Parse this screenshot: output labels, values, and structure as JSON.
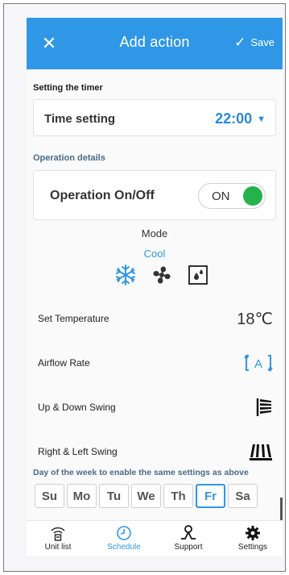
{
  "header": {
    "title": "Add action",
    "save_label": "Save",
    "close_icon": "close-icon",
    "accent": "#2f97e6"
  },
  "timer": {
    "section_label": "Setting the timer",
    "label": "Time setting",
    "value": "22:00"
  },
  "operation": {
    "section_label": "Operation details",
    "label": "Operation On/Off",
    "toggle_text": "ON",
    "toggle_on": true,
    "toggle_color": "#24b34b"
  },
  "mode": {
    "label": "Mode",
    "selected": "Cool",
    "icons": [
      "snowflake-icon",
      "fan-icon",
      "dry-icon"
    ]
  },
  "settings": [
    {
      "label": "Set Temperature",
      "value": "18℃"
    },
    {
      "label": "Airflow Rate",
      "icon": "airflow-auto-icon",
      "icon_text": "A"
    },
    {
      "label": "Up & Down Swing",
      "icon": "vertical-swing-icon"
    },
    {
      "label": "Right & Left Swing",
      "icon": "horizontal-swing-icon"
    }
  ],
  "days": {
    "title": "Day of the week to enable the same settings as above",
    "items": [
      "Su",
      "Mo",
      "Tu",
      "We",
      "Th",
      "Fr",
      "Sa"
    ],
    "selected": "Fr"
  },
  "tabs": [
    {
      "label": "Unit list",
      "icon": "wifi-unit-icon"
    },
    {
      "label": "Schedule",
      "icon": "clock-icon",
      "active": true
    },
    {
      "label": "Support",
      "icon": "support-person-icon"
    },
    {
      "label": "Settings",
      "icon": "gear-icon"
    }
  ]
}
